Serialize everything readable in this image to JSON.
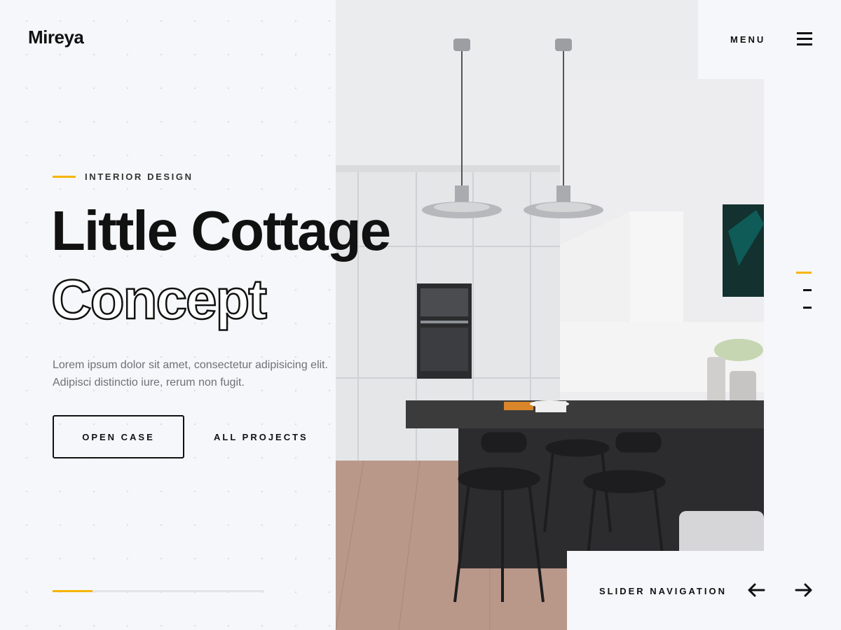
{
  "brand": {
    "logo": "Mireya"
  },
  "header": {
    "menu_label": "MENU"
  },
  "hero": {
    "eyebrow": "INTERIOR DESIGN",
    "title_line1": "Little Cottage",
    "title_line2": "Concept",
    "description_line1": "Lorem ipsum dolor sit amet, consectetur adipisicing elit.",
    "description_line2": "Adipisci distinctio iure, rerum non fugit.",
    "primary_button": "OPEN CASE",
    "secondary_link": "ALL PROJECTS"
  },
  "slider": {
    "nav_label": "SLIDER NAVIGATION",
    "progress_fraction": 0.19,
    "active_slide": 1,
    "slide_count": 3
  },
  "icons": {
    "menu": "hamburger-icon",
    "prev": "arrow-left-icon",
    "next": "arrow-right-icon"
  },
  "colors": {
    "accent": "#f7b500",
    "background": "#f5f7fa",
    "text": "#111111"
  }
}
